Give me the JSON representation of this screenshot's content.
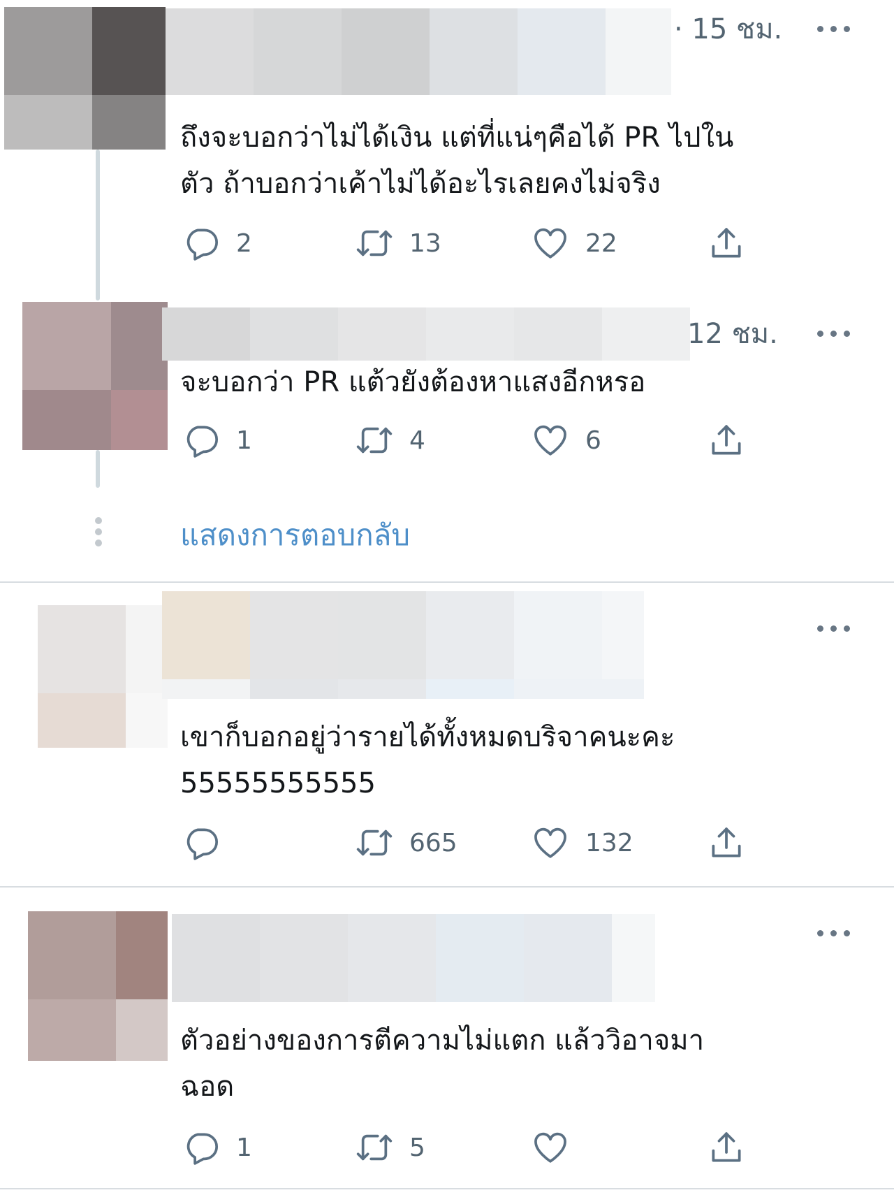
{
  "tweets": [
    {
      "time": "· 15 ชม.",
      "text": "ถึงจะบอกว่าไม่ได้เงิน แต่ที่แน่ๆคือได้ PR ไปใน\nตัว   ถ้าบอกว่าเค้าไม่ได้อะไรเลยคงไม่จริง",
      "reply_count": "2",
      "retweet_count": "13",
      "like_count": "22"
    },
    {
      "time": "12 ชม.",
      "text": "จะบอกว่า PR แต้วยังต้องหาแสงอีกหรอ",
      "reply_count": "1",
      "retweet_count": "4",
      "like_count": "6"
    },
    {
      "time": "",
      "text": "เขาก็บอกอยู่ว่ารายได้ทั้งหมดบริจาคนะคะ\n55555555555",
      "reply_count": "",
      "retweet_count": "665",
      "like_count": "132"
    },
    {
      "time": "",
      "text": "ตัวอย่างของการตีความไม่แตก แล้ววิอาจมา\nฉอด",
      "reply_count": "1",
      "retweet_count": "5",
      "like_count": ""
    }
  ],
  "show_replies_label": "แสดงการตอบกลับ",
  "icons": {
    "reply": "reply-icon",
    "retweet": "retweet-icon",
    "like": "heart-icon",
    "share": "share-icon",
    "more": "more-icon"
  },
  "colors": {
    "text": "#14171a",
    "secondary": "#536471",
    "link": "#4e8fc9",
    "icon": "#5b7083",
    "thread_line": "#cfd9de",
    "divider": "#d8dde1"
  }
}
